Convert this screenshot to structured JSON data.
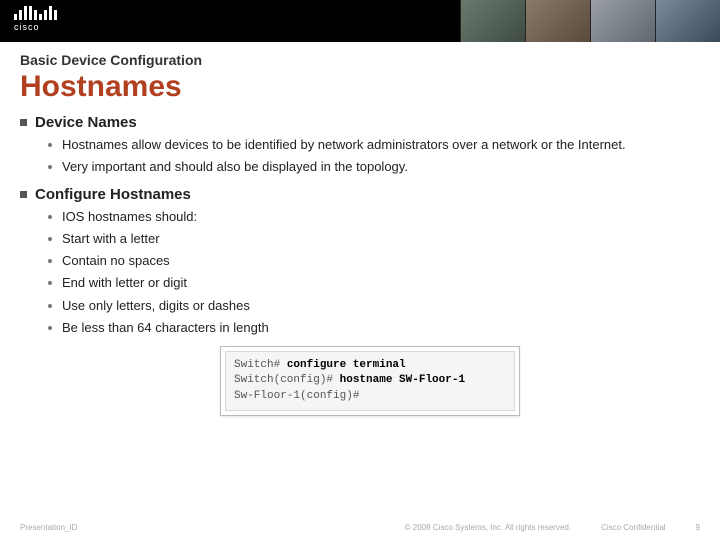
{
  "logo_text": "cisco",
  "kicker": "Basic Device Configuration",
  "title": "Hostnames",
  "sections": [
    {
      "heading": "Device Names",
      "items": [
        "Hostnames allow devices to be identified by network administrators over a network or the Internet.",
        "Very important and should also be displayed in the topology."
      ]
    },
    {
      "heading": "Configure Hostnames",
      "items": [
        "IOS hostnames should:",
        "Start with a letter",
        "Contain no spaces",
        "End with letter or digit",
        "Use only letters, digits or dashes",
        "Be less than 64 characters in length"
      ]
    }
  ],
  "terminal": {
    "l1a": "Switch# ",
    "l1b": "configure terminal",
    "l2a": "Switch(config)# ",
    "l2b": "hostname SW-Floor-1",
    "l3a": "Sw-Floor-1(config)#"
  },
  "footer": {
    "left": "Presentation_ID",
    "center": "© 2008 Cisco Systems, Inc. All rights reserved.",
    "conf": "Cisco Confidential",
    "page": "9"
  }
}
